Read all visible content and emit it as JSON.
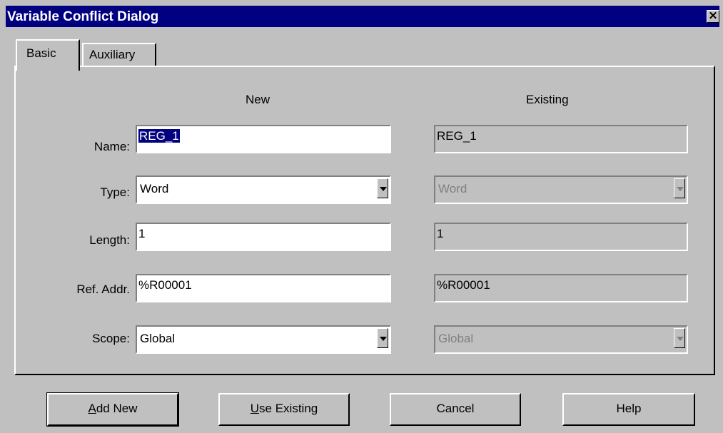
{
  "window": {
    "title": "Variable Conflict Dialog",
    "close_glyph": "✕"
  },
  "tabs": [
    {
      "label": "Basic",
      "active": true
    },
    {
      "label": "Auxiliary",
      "active": false
    }
  ],
  "columns": {
    "new": "New",
    "existing": "Existing"
  },
  "rows": {
    "name": {
      "label": "Name:",
      "new_value": "REG_1",
      "existing_value": "REG_1"
    },
    "type": {
      "label": "Type:",
      "new_value": "Word",
      "existing_value": "Word"
    },
    "length": {
      "label": "Length:",
      "new_value": "1",
      "existing_value": "1"
    },
    "ref": {
      "label": "Ref. Addr.",
      "new_value": "%R00001",
      "existing_value": "%R00001"
    },
    "scope": {
      "label": "Scope:",
      "new_value": "Global",
      "existing_value": "Global"
    }
  },
  "buttons": {
    "add_new": {
      "mnemonic": "A",
      "rest": "dd New"
    },
    "use_existing": {
      "mnemonic": "U",
      "rest": "se Existing"
    },
    "cancel": "Cancel",
    "help": "Help"
  },
  "colors": {
    "titlebar": "#000080",
    "face": "#c0c0c0",
    "disabled_text": "#808080"
  }
}
